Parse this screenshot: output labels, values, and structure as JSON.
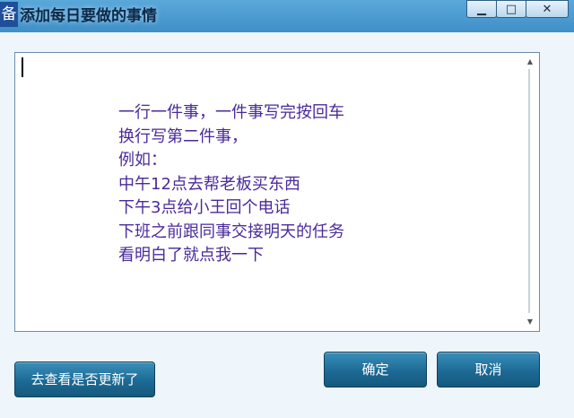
{
  "window": {
    "icon_glyph": "备",
    "title": "添加每日要做的事情",
    "controls": {
      "minimize": "▁",
      "maximize": "□",
      "close": "✕"
    }
  },
  "editor": {
    "lines": [
      "一行一件事，一件事写完按回车",
      "换行写第二件事，",
      "例如：",
      "中午12点去帮老板买东西",
      "下午3点给小王回个电话",
      "下班之前跟同事交接明天的任务",
      "看明白了就点我一下"
    ],
    "scroll_up": "▲",
    "scroll_down": "▼"
  },
  "buttons": {
    "check_update": "去查看是否更新了",
    "ok": "确定",
    "cancel": "取消"
  },
  "colors": {
    "title_bg": "#3c8dc6",
    "text": "#4a2a9a",
    "button": "#1c6a95"
  }
}
